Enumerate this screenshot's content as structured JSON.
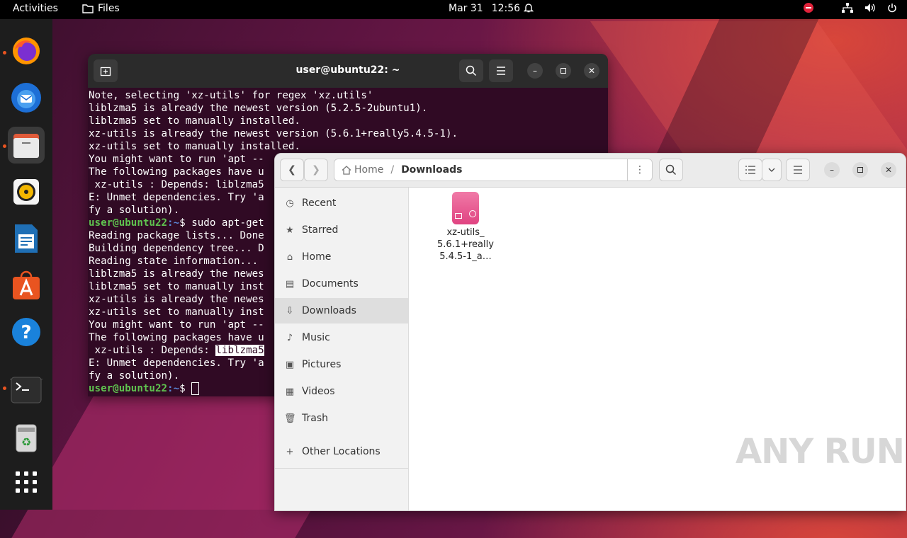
{
  "topbar": {
    "activities": "Activities",
    "app_name": "Files",
    "date": "Mar 31",
    "time": "12:56"
  },
  "dock": {
    "items": [
      "firefox-icon",
      "thunderbird-icon",
      "files-icon",
      "rhythmbox-icon",
      "libreoffice-writer-icon",
      "app-center-icon",
      "help-icon",
      "terminal-icon",
      "trash-icon",
      "show-apps-icon"
    ]
  },
  "terminal": {
    "title": "user@ubuntu22: ~",
    "lines": [
      "Note, selecting 'xz-utils' for regex 'xz.utils'",
      "liblzma5 is already the newest version (5.2.5-2ubuntu1).",
      "liblzma5 set to manually installed.",
      "xz-utils is already the newest version (5.6.1+really5.4.5-1).",
      "xz-utils set to manually installed.",
      "You might want to run 'apt --",
      "The following packages have u",
      " xz-utils : Depends: liblzma5",
      "E: Unmet dependencies. Try 'a",
      "fy a solution)."
    ],
    "prompt_user": "user@ubuntu22",
    "prompt_path": ":~",
    "prompt_cmd": "$ sudo apt-get",
    "lines2": [
      "Reading package lists... Done",
      "Building dependency tree... D",
      "Reading state information...",
      "liblzma5 is already the newes",
      "liblzma5 set to manually inst",
      "xz-utils is already the newes",
      "xz-utils set to manually inst",
      "You might want to run 'apt --",
      "The following packages have u"
    ],
    "depends_prefix": " xz-utils : Depends: ",
    "depends_highlight": "liblzma5",
    "lines3": [
      "E: Unmet dependencies. Try 'a",
      "fy a solution)."
    ],
    "prompt_final": "$ "
  },
  "files": {
    "breadcrumb_home": "Home",
    "breadcrumb_current": "Downloads",
    "sidebar": [
      {
        "label": "Recent",
        "icon": "clock-icon"
      },
      {
        "label": "Starred",
        "icon": "star-icon"
      },
      {
        "label": "Home",
        "icon": "home-icon"
      },
      {
        "label": "Documents",
        "icon": "document-icon"
      },
      {
        "label": "Downloads",
        "icon": "download-icon"
      },
      {
        "label": "Music",
        "icon": "music-icon"
      },
      {
        "label": "Pictures",
        "icon": "picture-icon"
      },
      {
        "label": "Videos",
        "icon": "video-icon"
      },
      {
        "label": "Trash",
        "icon": "trash-icon"
      }
    ],
    "other_locations": "Other Locations",
    "file": {
      "name_line1": "xz-utils_",
      "name_line2": "5.6.1+really",
      "name_line3": "5.4.5-1_a…"
    }
  },
  "watermark": "ANY RUN"
}
